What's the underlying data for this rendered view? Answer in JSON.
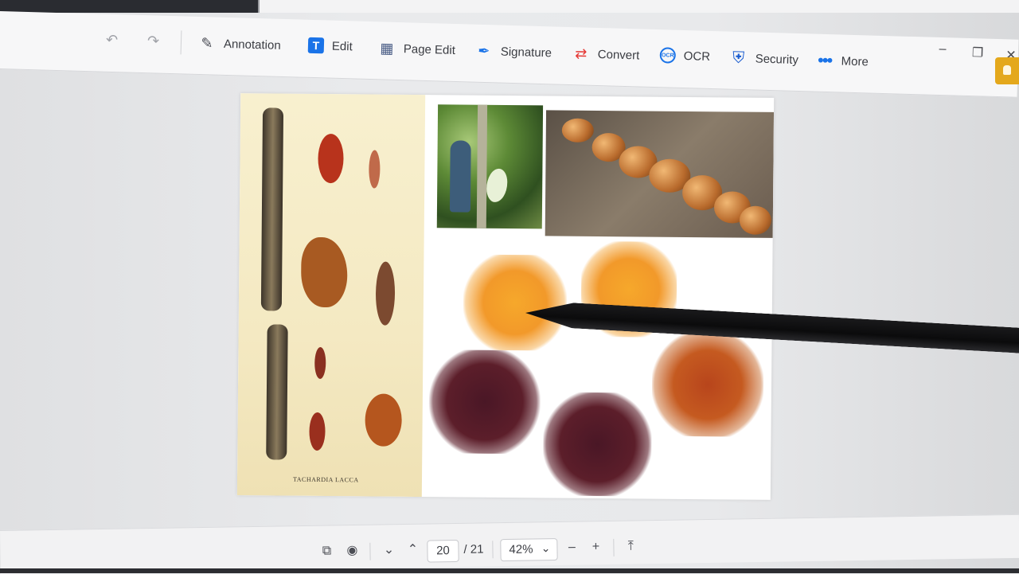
{
  "toolbar": {
    "items": [
      {
        "label": "Annotation",
        "icon": "pen-icon"
      },
      {
        "label": "Edit",
        "icon": "text-edit-icon"
      },
      {
        "label": "Page Edit",
        "icon": "grid-icon"
      },
      {
        "label": "Signature",
        "icon": "signature-pen-icon"
      },
      {
        "label": "Convert",
        "icon": "convert-arrows-icon"
      },
      {
        "label": "OCR",
        "icon": "ocr-icon"
      },
      {
        "label": "Security",
        "icon": "shield-icon"
      },
      {
        "label": "More",
        "icon": "more-dots-icon"
      }
    ],
    "undo_icon": "undo-icon",
    "redo_icon": "redo-icon",
    "colors": {
      "icon_blue": "#1a73e8",
      "convert_red": "#e53935",
      "security_blue": "#1e5fd0"
    }
  },
  "window": {
    "minimize": "–",
    "restore": "❐",
    "close": "✕"
  },
  "document": {
    "plate_caption": "TACHARDIA LACCA"
  },
  "bottom_bar": {
    "current_page": "20",
    "total_pages": "/ 21",
    "zoom": "42%",
    "zoom_out": "–",
    "zoom_in": "+"
  }
}
